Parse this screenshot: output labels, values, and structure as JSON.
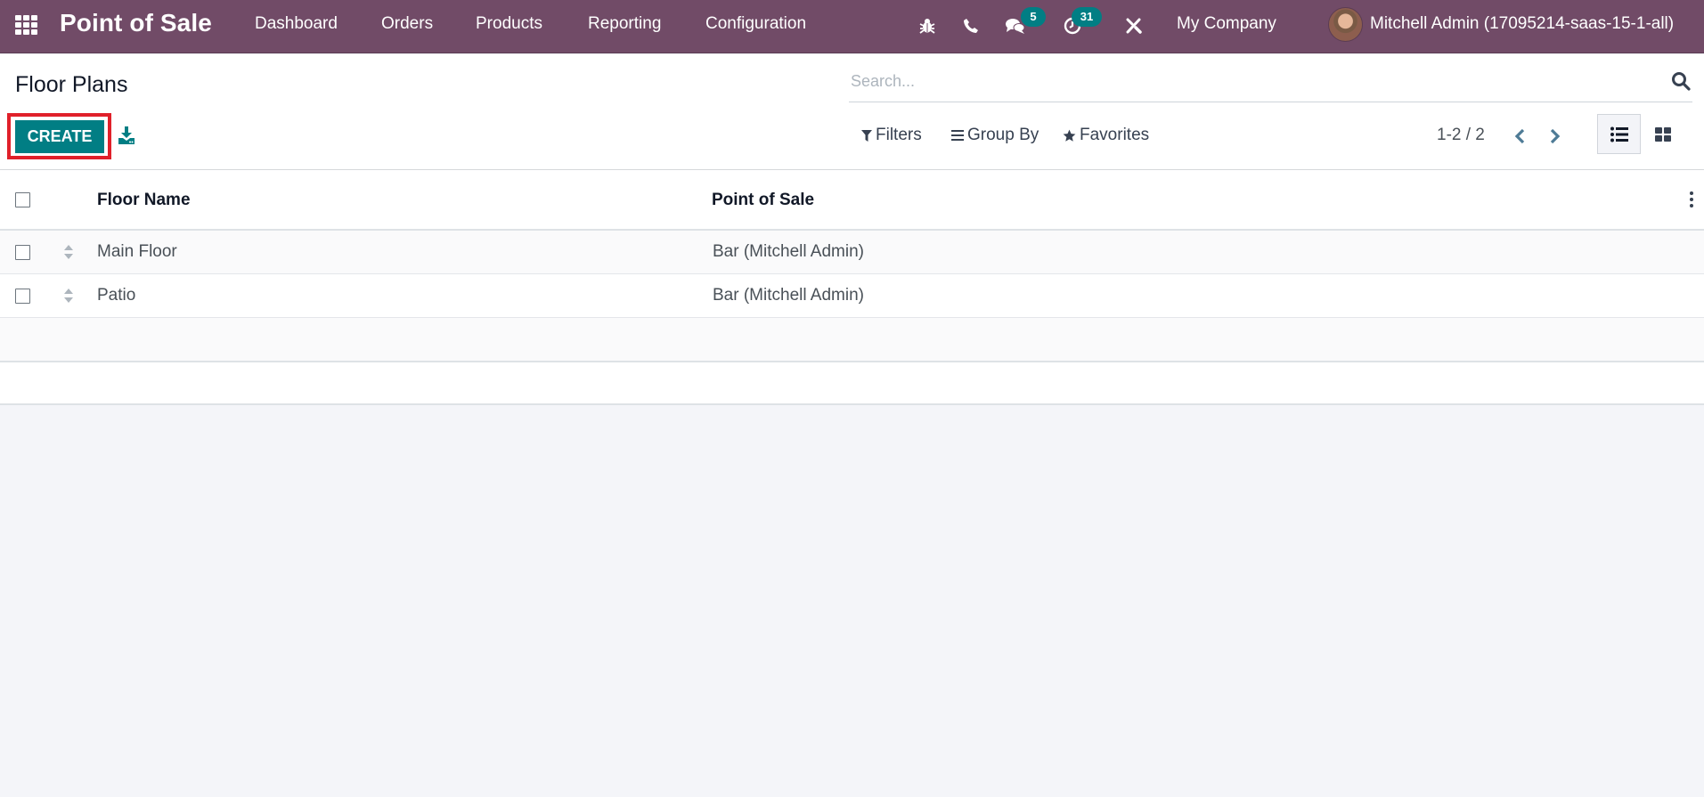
{
  "navbar": {
    "app_name": "Point of Sale",
    "menu": [
      {
        "label": "Dashboard"
      },
      {
        "label": "Orders"
      },
      {
        "label": "Products"
      },
      {
        "label": "Reporting"
      },
      {
        "label": "Configuration"
      }
    ],
    "systray": {
      "debug_icon": "bug-icon",
      "phone_icon": "phone-icon",
      "messages_icon": "chat-icon",
      "messages_count": "5",
      "activities_icon": "clock-icon",
      "activities_count": "31",
      "settings_icon": "tools-icon"
    },
    "company": "My Company",
    "user": "Mitchell Admin (17095214-saas-15-1-all)",
    "brand_color": "#714b67"
  },
  "control_panel": {
    "title": "Floor Plans",
    "create_label": "CREATE",
    "create_color": "#017e84",
    "download_icon": "download-icon",
    "search": {
      "placeholder": "Search...",
      "value": ""
    },
    "filters_label": "Filters",
    "group_by_label": "Group By",
    "favorites_label": "Favorites",
    "pager": "1-2 / 2",
    "views": [
      "list",
      "kanban"
    ],
    "active_view": "list"
  },
  "table": {
    "columns": [
      "Floor Name",
      "Point of Sale"
    ],
    "rows": [
      {
        "floor_name": "Main Floor",
        "point_of_sale": "Bar (Mitchell Admin)"
      },
      {
        "floor_name": "Patio",
        "point_of_sale": "Bar (Mitchell Admin)"
      }
    ]
  }
}
